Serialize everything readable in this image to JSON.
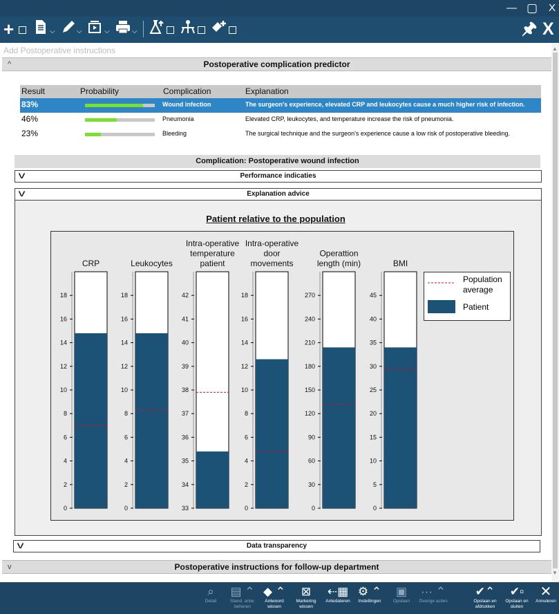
{
  "window": {
    "minimize": "—",
    "maximize": "▢",
    "close": "X"
  },
  "toolbar": {
    "icons": [
      "add-icon",
      "document-icon",
      "edit-icon",
      "present-icon",
      "print-icon",
      "lab-icon",
      "workflow-icon",
      "add-medication-icon"
    ],
    "pin": "🖈",
    "close": "X"
  },
  "placeholder": "Add Postoperative instructions",
  "sections": {
    "predictor": "Postoperative complication predictor",
    "followup": "Postoperative instructions for follow-up department"
  },
  "table": {
    "headers": {
      "result": "Result",
      "probability": "Probability",
      "complication": "Complication",
      "explanation": "Explanation"
    },
    "rows": [
      {
        "result": "83%",
        "probability": 83,
        "complication": "Wound infection",
        "explanation": "The surgeon's experience, elevated CRP and leukocytes cause a much higher risk of infection.",
        "selected": true
      },
      {
        "result": "46%",
        "probability": 46,
        "complication": "Pneumonia",
        "explanation": "Elevated CRP, leukocytes, and temperature increase the risk of pneumonia.",
        "selected": false
      },
      {
        "result": "23%",
        "probability": 23,
        "complication": "Bleeding",
        "explanation": "The surgical technique and the surgeon's experience cause a low risk of postoperative bleeding.",
        "selected": false
      }
    ]
  },
  "detail": {
    "title": "Complication: Postoperative wound infection",
    "performance": "Performance indicaties",
    "advice": "Explanation advice",
    "transparency": "Data transparency"
  },
  "colors": {
    "patient": "#1d5277",
    "average": "#c8102e",
    "selected_row": "#2f86c6",
    "prob_bar": "#7ae029",
    "dark_bar": "#1e4664"
  },
  "chart_data": {
    "type": "bar",
    "title": "Patient relative to the population",
    "legend": {
      "average": "Population average",
      "patient": "Patient",
      "placement": "top-right"
    },
    "panels": [
      {
        "label": [
          "CRP"
        ],
        "ticks": [
          0,
          2,
          4,
          6,
          8,
          10,
          12,
          14,
          16,
          18
        ],
        "min": 0,
        "max": 20,
        "patient": 14.8,
        "average": 7
      },
      {
        "label": [
          "Leukocytes"
        ],
        "ticks": [
          0,
          2,
          4,
          6,
          8,
          10,
          12,
          14,
          16,
          18
        ],
        "min": 0,
        "max": 20,
        "patient": 14.8,
        "average": 8.3
      },
      {
        "label": [
          "Intra-operative",
          "temperature",
          "patient"
        ],
        "ticks": [
          33,
          34,
          35,
          36,
          37,
          38,
          39,
          40,
          41,
          42
        ],
        "min": 33,
        "max": 43,
        "patient": 35.4,
        "average": 37.9
      },
      {
        "label": [
          "Intra-operative",
          "door",
          "movements"
        ],
        "ticks": [
          0,
          2,
          4,
          6,
          8,
          10,
          12,
          14,
          16,
          18
        ],
        "min": 0,
        "max": 20,
        "patient": 12.6,
        "average": 4.8
      },
      {
        "label": [
          "Operattion",
          "length (min)"
        ],
        "ticks": [
          0,
          30,
          60,
          90,
          120,
          150,
          180,
          210,
          240,
          270
        ],
        "min": 0,
        "max": 300,
        "patient": 204,
        "average": 132
      },
      {
        "label": [
          "BMI"
        ],
        "ticks": [
          0,
          5,
          10,
          15,
          20,
          25,
          30,
          35,
          40,
          45
        ],
        "min": 0,
        "max": 50,
        "patient": 34,
        "average": 29.4
      }
    ]
  },
  "bottombar": {
    "items": [
      {
        "icon": "search-icon",
        "label": "Detail"
      },
      {
        "icon": "default-text-icon",
        "label": "Stand. antw. beheren"
      },
      {
        "icon": "eraser-icon",
        "label": "Antwoord wissen"
      },
      {
        "icon": "clear-marking-icon",
        "label": "Markering wissen"
      },
      {
        "icon": "antedate-icon",
        "label": "Antedateren"
      },
      {
        "icon": "gear-icon",
        "label": "Instellingen"
      },
      {
        "icon": "save-icon",
        "label": "Opslaan"
      },
      {
        "icon": "more-icon",
        "label": "Overige acties"
      },
      {
        "icon": "save-print-icon",
        "label": "Opslaan en afdrukken"
      },
      {
        "icon": "save-close-icon",
        "label": "Opslaan en sluiten"
      },
      {
        "icon": "close-icon",
        "label": "Annuleren"
      }
    ]
  }
}
